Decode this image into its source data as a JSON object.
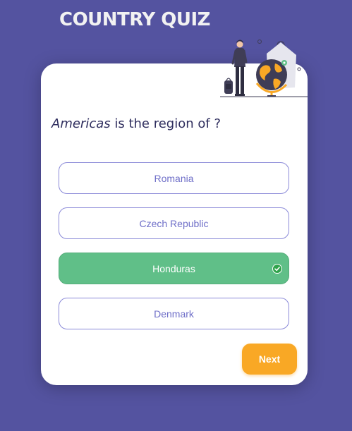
{
  "app": {
    "title": "COUNTRY QUIZ"
  },
  "question": {
    "region": "Americas",
    "suffix": " is the region of ?"
  },
  "options": [
    {
      "label": "Romania",
      "state": "default"
    },
    {
      "label": "Czech Republic",
      "state": "default"
    },
    {
      "label": "Honduras",
      "state": "correct"
    },
    {
      "label": "Denmark",
      "state": "default"
    }
  ],
  "next_button": {
    "label": "Next"
  },
  "colors": {
    "background": "#5453a0",
    "card": "#ffffff",
    "option_border": "#8a89d8",
    "option_text": "#6f6fc8",
    "correct": "#60bf88",
    "accent": "#f9a825"
  },
  "icons": {
    "header_illustration": "traveler-with-globe-illustration",
    "correct_marker": "check-circle-icon"
  }
}
